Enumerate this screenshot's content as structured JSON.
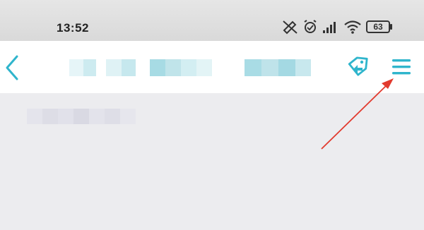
{
  "status_bar": {
    "time": "13:52",
    "battery_level": "63"
  },
  "header": {
    "back_icon": "chevron-left-icon",
    "title_obscured": true,
    "tag_icon": "tag-swap-icon",
    "menu_icon": "hamburger-menu-icon"
  },
  "colors": {
    "accent": "#2fb5cc",
    "mosaic_light": "#d6eef2",
    "mosaic_mid": "#b9e1e8",
    "annotation": "#e23a2e",
    "status_bar_bg": "#e0e0e0",
    "content_bg": "#ececef"
  }
}
